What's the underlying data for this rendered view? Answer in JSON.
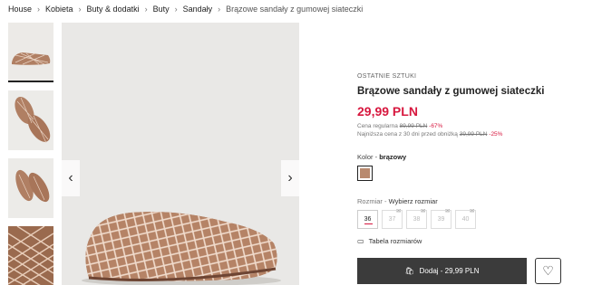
{
  "breadcrumb": {
    "items": [
      "House",
      "Kobieta",
      "Buty & dodatki",
      "Buty",
      "Sandały",
      "Brązowe sandały z gumowej siateczki"
    ]
  },
  "product": {
    "tag": "OSTATNIE SZTUKI",
    "title": "Brązowe sandały z gumowej siateczki",
    "price": "29,99 PLN",
    "regular_label": "Cena regularna",
    "regular_price": "89,99 PLN",
    "regular_discount": "-67%",
    "lowest_label": "Najniższa cena z 30 dni przed obniżką",
    "lowest_price": "39,99 PLN",
    "lowest_discount": "-25%"
  },
  "color": {
    "label": "Kolor",
    "value": "brązowy",
    "swatch_hex": "#b98a6f"
  },
  "size": {
    "label": "Rozmiar",
    "prompt": "Wybierz rozmiar",
    "options": [
      "36",
      "37",
      "38",
      "39",
      "40"
    ],
    "selected": "36"
  },
  "size_table_label": "Tabela rozmiarów",
  "add_button_label": "Dodaj - 29,99 PLN",
  "icons": {
    "prev": "chevron-left-icon",
    "next": "chevron-right-icon",
    "bag": "shopping-bag-icon",
    "heart": "heart-icon",
    "ruler": "ruler-icon",
    "mail": "envelope-icon"
  },
  "colors": {
    "price_red": "#d7183f",
    "button_dark": "#3b3b3b"
  }
}
